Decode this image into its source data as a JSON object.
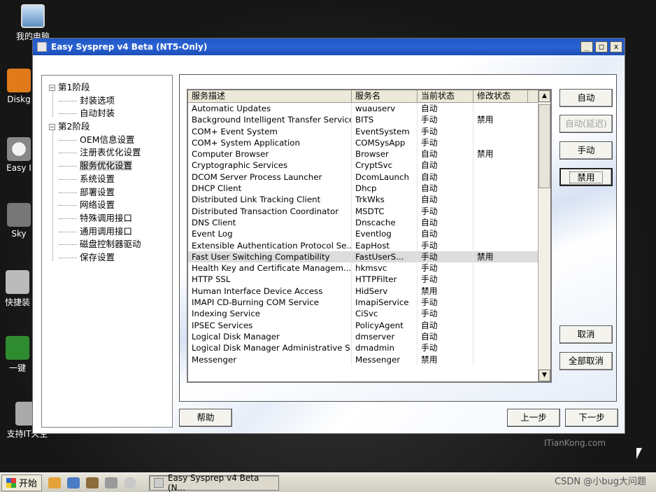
{
  "desktop": {
    "icons": [
      {
        "label": "我的电脑",
        "icon": "computer-icon"
      },
      {
        "label": "Diskg",
        "icon": "disk-icon"
      },
      {
        "label": "Easy I",
        "icon": "ghost-icon"
      },
      {
        "label": "Sky",
        "icon": "sky-icon"
      },
      {
        "label": "快捷装",
        "icon": "install-icon"
      },
      {
        "label": "一键",
        "icon": "key-icon"
      },
      {
        "label": "支持IT天空",
        "icon": "support-icon"
      }
    ]
  },
  "window": {
    "title": "Easy Sysprep v4 Beta (NT5-Only)",
    "controls": {
      "minimize": "_",
      "maximize": "□",
      "close": "x"
    }
  },
  "tree": {
    "items": [
      {
        "label": "第1阶段",
        "level": 0,
        "expander": "−"
      },
      {
        "label": "封装选项",
        "level": 1
      },
      {
        "label": "自动封装",
        "level": 1
      },
      {
        "label": "第2阶段",
        "level": 0,
        "expander": "−"
      },
      {
        "label": "OEM信息设置",
        "level": 1
      },
      {
        "label": "注册表优化设置",
        "level": 1
      },
      {
        "label": "服务优化设置",
        "level": 1,
        "selected": true
      },
      {
        "label": "系统设置",
        "level": 1
      },
      {
        "label": "部署设置",
        "level": 1
      },
      {
        "label": "网络设置",
        "level": 1
      },
      {
        "label": "特殊调用接口",
        "level": 1
      },
      {
        "label": "通用调用接口",
        "level": 1
      },
      {
        "label": "磁盘控制器驱动",
        "level": 1
      },
      {
        "label": "保存设置",
        "level": 1
      }
    ]
  },
  "services": {
    "columns": [
      "服务描述",
      "服务名",
      "当前状态",
      "修改状态"
    ],
    "rows": [
      [
        "Automatic Updates",
        "wuauserv",
        "自动",
        ""
      ],
      [
        "Background Intelligent Transfer Service",
        "BITS",
        "手动",
        "禁用"
      ],
      [
        "COM+ Event System",
        "EventSystem",
        "手动",
        ""
      ],
      [
        "COM+ System Application",
        "COMSysApp",
        "手动",
        ""
      ],
      [
        "Computer Browser",
        "Browser",
        "自动",
        "禁用"
      ],
      [
        "Cryptographic Services",
        "CryptSvc",
        "自动",
        ""
      ],
      [
        "DCOM Server Process Launcher",
        "DcomLaunch",
        "自动",
        ""
      ],
      [
        "DHCP Client",
        "Dhcp",
        "自动",
        ""
      ],
      [
        "Distributed Link Tracking Client",
        "TrkWks",
        "自动",
        ""
      ],
      [
        "Distributed Transaction Coordinator",
        "MSDTC",
        "手动",
        ""
      ],
      [
        "DNS Client",
        "Dnscache",
        "自动",
        ""
      ],
      [
        "Event Log",
        "Eventlog",
        "自动",
        ""
      ],
      [
        "Extensible Authentication Protocol Se...",
        "EapHost",
        "手动",
        ""
      ],
      [
        "Fast User Switching Compatibility",
        "FastUserS...",
        "手动",
        "禁用"
      ],
      [
        "Health Key and Certificate Managem...",
        "hkmsvc",
        "手动",
        ""
      ],
      [
        "HTTP SSL",
        "HTTPFilter",
        "手动",
        ""
      ],
      [
        "Human Interface Device Access",
        "HidServ",
        "禁用",
        ""
      ],
      [
        "IMAPI CD-Burning COM Service",
        "ImapiService",
        "手动",
        ""
      ],
      [
        "Indexing Service",
        "CiSvc",
        "手动",
        ""
      ],
      [
        "IPSEC Services",
        "PolicyAgent",
        "自动",
        ""
      ],
      [
        "Logical Disk Manager",
        "dmserver",
        "自动",
        ""
      ],
      [
        "Logical Disk Manager Administrative S...",
        "dmadmin",
        "手动",
        ""
      ],
      [
        "Messenger",
        "Messenger",
        "禁用",
        ""
      ]
    ],
    "selected_row": 13
  },
  "buttons": {
    "auto": "自动",
    "auto_delayed": "自动(延迟)",
    "manual": "手动",
    "disable": "禁用",
    "cancel": "取消",
    "cancel_all": "全部取消",
    "help": "帮助",
    "prev": "上一步",
    "next": "下一步"
  },
  "taskbar": {
    "start": "开始",
    "task": "Easy Sysprep v4 Beta (N..."
  },
  "watermarks": {
    "itiankong": "ITianKong.com",
    "csdn": "CSDN @小bug大问题"
  }
}
